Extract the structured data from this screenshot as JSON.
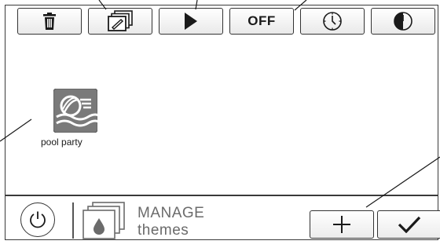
{
  "toolbar": {
    "buttons": [
      {
        "name": "delete",
        "icon": "trash-icon"
      },
      {
        "name": "edit",
        "icon": "edit-stack-icon"
      },
      {
        "name": "play",
        "icon": "play-icon"
      },
      {
        "name": "off",
        "label": "OFF"
      },
      {
        "name": "timer",
        "icon": "clock-icon"
      },
      {
        "name": "schedule",
        "icon": "half-clock-icon"
      }
    ]
  },
  "themes": [
    {
      "label": "pool party",
      "icon": "pool-party-theme-icon"
    }
  ],
  "footer": {
    "manage_title": "MANAGE",
    "manage_sub": "themes",
    "add_icon": "plus-icon",
    "confirm_icon": "checkmark-icon"
  },
  "colors": {
    "border": "#3a3a3a",
    "tile": "#7a7a7a",
    "label_muted": "#6b6b6b"
  }
}
